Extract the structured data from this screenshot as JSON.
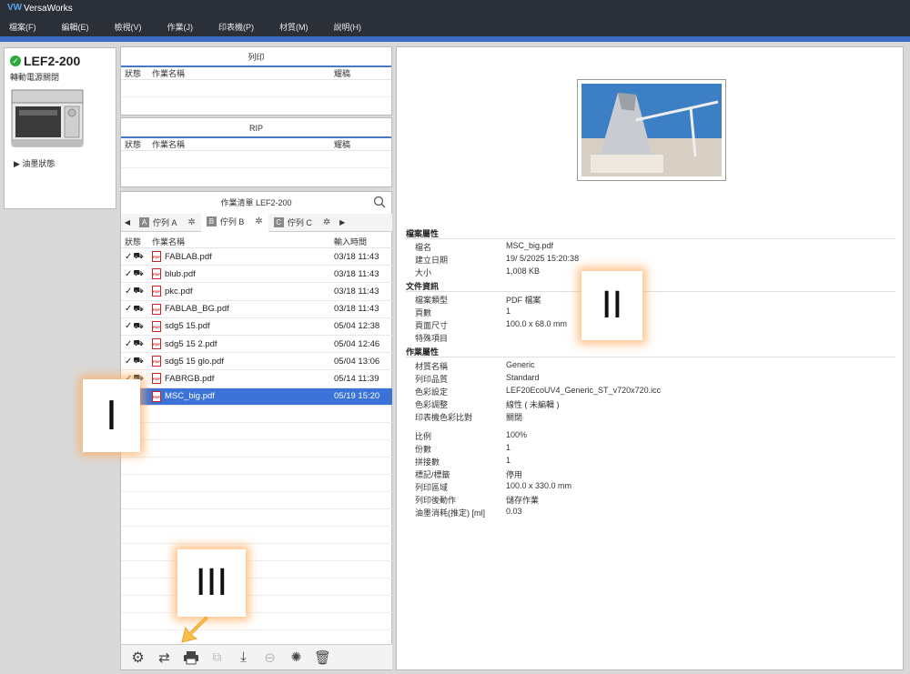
{
  "app": {
    "title": "VersaWorks",
    "logo": "VW"
  },
  "menu": [
    "檔案(F)",
    "編輯(E)",
    "檢視(V)",
    "作業(J)",
    "印表機(P)",
    "材質(M)",
    "說明(H)"
  ],
  "printer": {
    "name": "LEF2-200",
    "status": "轉動電源關閉",
    "ink_label": "油墨狀態"
  },
  "print_panel": {
    "title": "列印",
    "col_status": "狀態",
    "col_name": "作業名稱",
    "col_extra": "耀稿"
  },
  "rip_panel": {
    "title": "RIP",
    "col_status": "狀態",
    "col_name": "作業名稱",
    "col_extra": "耀稿"
  },
  "queue": {
    "title": "作業清單 LEF2-200",
    "tabs": [
      {
        "letter": "A",
        "label": "佇列 A"
      },
      {
        "letter": "B",
        "label": "佇列 B"
      },
      {
        "letter": "C",
        "label": "佇列 C"
      }
    ],
    "col_status": "狀態",
    "col_name": "作業名稱",
    "col_time": "輸入時間",
    "jobs": [
      {
        "name": "FABLAB.pdf",
        "time": "03/18 11:43"
      },
      {
        "name": "blub.pdf",
        "time": "03/18 11:43"
      },
      {
        "name": "pkc.pdf",
        "time": "03/18 11:43"
      },
      {
        "name": "FABLAB_BG.pdf",
        "time": "03/18 11:43"
      },
      {
        "name": "sdg5 15.pdf",
        "time": "05/04 12:38"
      },
      {
        "name": "sdg5 15 2.pdf",
        "time": "05/04 12:46"
      },
      {
        "name": "sdg5 15 glo.pdf",
        "time": "05/04 13:06"
      },
      {
        "name": "FABRGB.pdf",
        "time": "05/14 11:39"
      },
      {
        "name": "MSC_big.pdf",
        "time": "05/19 15:20"
      }
    ]
  },
  "props": {
    "file_section": "檔案屬性",
    "file": [
      [
        "檔名",
        "MSC_big.pdf"
      ],
      [
        "建立日期",
        "19/ 5/2025 15:20:38"
      ],
      [
        "大小",
        "1,008 KB"
      ]
    ],
    "doc_section": "文件資訊",
    "doc": [
      [
        "檔案類型",
        "PDF 檔案"
      ],
      [
        "頁數",
        "1"
      ],
      [
        "頁面尺寸",
        "100.0 x 68.0 mm"
      ],
      [
        "特殊項目",
        ""
      ]
    ],
    "job_section": "作業屬性",
    "job": [
      [
        "材質名稱",
        "Generic"
      ],
      [
        "列印品質",
        "Standard"
      ],
      [
        "色彩設定",
        "LEF20EcoUV4_Generic_ST_v720x720.icc"
      ],
      [
        "色彩調整",
        "線性 ( 未編輯 )"
      ],
      [
        "印表機色彩比對",
        "關閉"
      ]
    ],
    "layout": [
      [
        "比例",
        "100%"
      ],
      [
        "份數",
        "1"
      ],
      [
        "拼接數",
        "1"
      ],
      [
        "標記/標籤",
        "停用"
      ],
      [
        "列印區域",
        "100.0 x 330.0 mm"
      ],
      [
        "列印後動作",
        "儲存作業"
      ],
      [
        "油墨消耗(推定) [ml]",
        "0.03"
      ]
    ]
  },
  "callouts": {
    "one": "I",
    "two": "II",
    "three": "III"
  },
  "colors": {
    "accent": "#3d6cc8",
    "selected": "#3a72d8",
    "titlebar": "#2b2f38"
  }
}
